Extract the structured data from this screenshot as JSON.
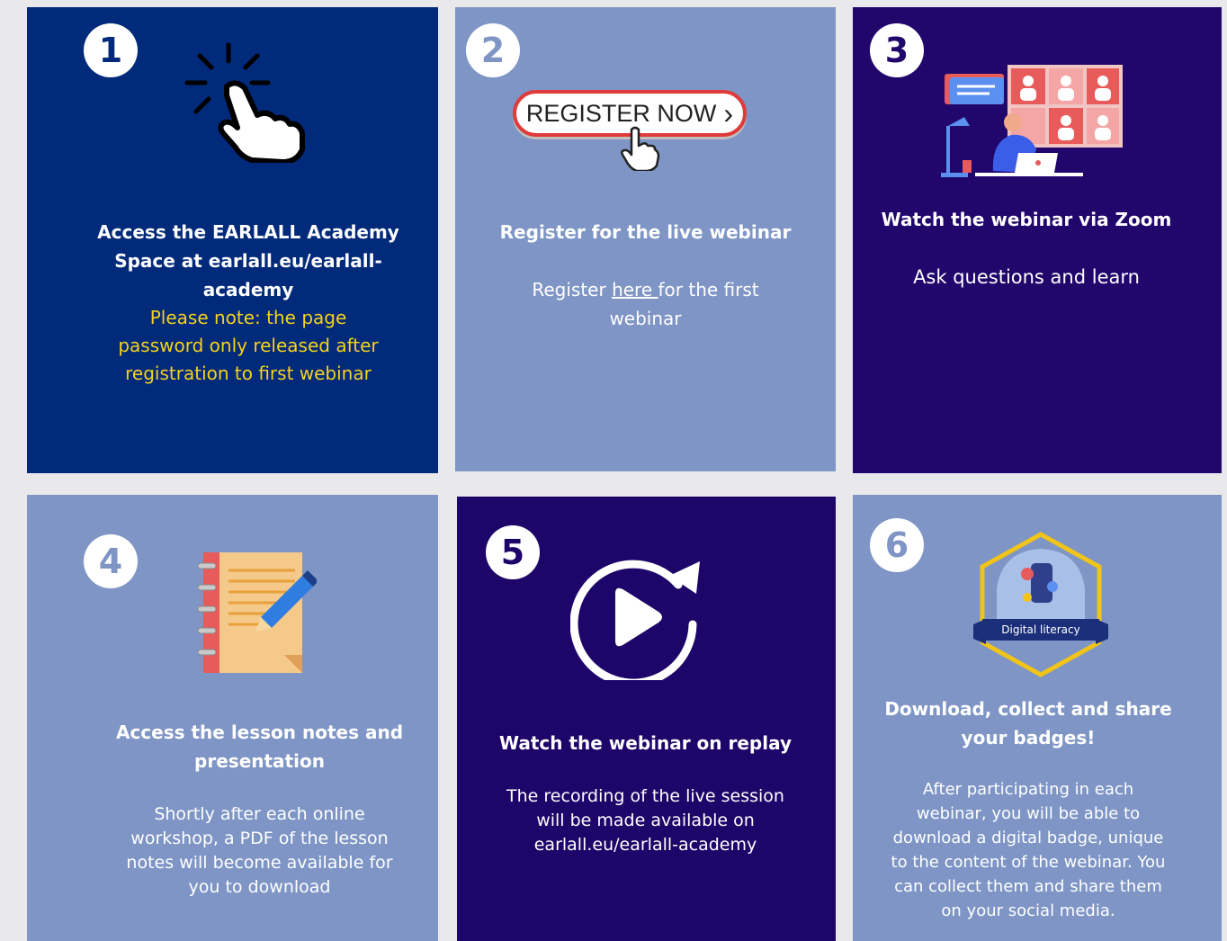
{
  "colors": {
    "dark_blue": "#012a7a",
    "light_blue": "#7e95c5",
    "purple": "#21066b",
    "yellow_note": "#f5d21c",
    "white": "#ffffff",
    "badge_gold": "#f0c419",
    "register_red": "#e03a3a"
  },
  "steps": [
    {
      "number": "1",
      "icon": "tap-hand-icon",
      "title_lines": [
        "Access the EARLALL Academy",
        "Space at earlall.eu/earlall-",
        "academy"
      ],
      "note_lines": [
        "Please note:  the page",
        "password only released after",
        "registration to first webinar"
      ]
    },
    {
      "number": "2",
      "icon": "register-button-icon",
      "register_label": "REGISTER NOW",
      "register_chevron": "›",
      "title": "Register for the live webinar",
      "desc_pre": "Register ",
      "desc_link": "here ",
      "desc_post": "for the first",
      "desc_line2": "webinar"
    },
    {
      "number": "3",
      "icon": "video-conference-icon",
      "title": "Watch the webinar via Zoom",
      "desc": "Ask questions and learn"
    },
    {
      "number": "4",
      "icon": "notebook-pencil-icon",
      "title_lines": [
        "Access the lesson notes and",
        "presentation"
      ],
      "desc_lines": [
        "Shortly after each online",
        "workshop, a PDF of the lesson",
        "notes will become available for",
        "you to download"
      ]
    },
    {
      "number": "5",
      "icon": "replay-play-icon",
      "title": "Watch the webinar on replay",
      "desc_lines": [
        "The recording of the live session",
        "will be made available on",
        "earlall.eu/earlall-academy"
      ]
    },
    {
      "number": "6",
      "icon": "digital-badge-icon",
      "badge_label": "Digital literacy",
      "title_lines": [
        "Download, collect and share",
        "your badges!"
      ],
      "desc_lines": [
        "After participating in each",
        "webinar, you will be able to",
        "download a digital badge, unique",
        "to  the content of the webinar. You",
        "can collect them and share them",
        "on your social media."
      ]
    }
  ]
}
